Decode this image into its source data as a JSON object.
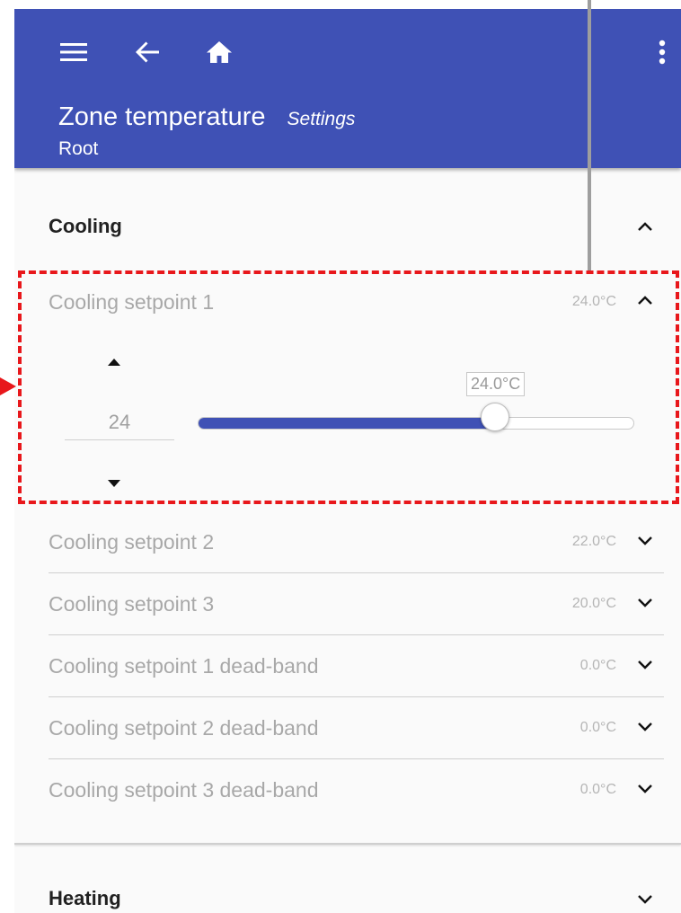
{
  "appbar": {
    "menu_icon": "menu-icon",
    "back_icon": "arrow-back-icon",
    "home_icon": "home-icon",
    "more_icon": "more-vert-icon",
    "title": "Zone temperature",
    "subtitle": "Settings",
    "breadcrumb": "Root",
    "color": "#3f51b5"
  },
  "sections": {
    "cooling": {
      "label": "Cooling",
      "expanded": true,
      "items": [
        {
          "label": "Cooling setpoint 1",
          "value": "24.0°C",
          "expanded": true
        },
        {
          "label": "Cooling setpoint 2",
          "value": "22.0°C",
          "expanded": false
        },
        {
          "label": "Cooling setpoint 3",
          "value": "20.0°C",
          "expanded": false
        },
        {
          "label": "Cooling setpoint 1 dead-band",
          "value": "0.0°C",
          "expanded": false
        },
        {
          "label": "Cooling setpoint 2 dead-band",
          "value": "0.0°C",
          "expanded": false
        },
        {
          "label": "Cooling setpoint 3 dead-band",
          "value": "0.0°C",
          "expanded": false
        }
      ]
    },
    "heating": {
      "label": "Heating",
      "expanded": false
    }
  },
  "editor": {
    "input_value": "24",
    "slider_tooltip": "24.0°C",
    "slider_fraction": 0.68
  },
  "annotation": {
    "highlight_color": "#e8171b"
  }
}
